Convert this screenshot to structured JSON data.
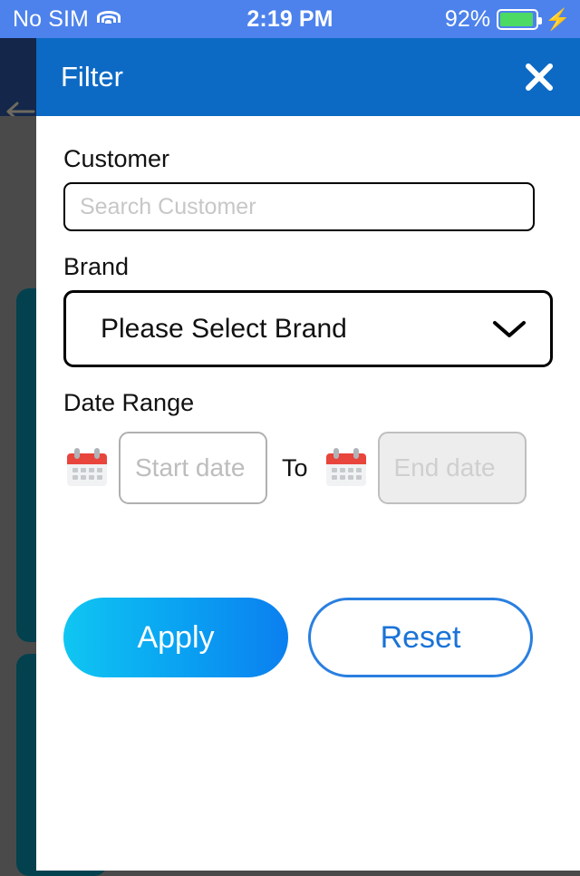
{
  "status_bar": {
    "carrier": "No SIM",
    "wifi_icon": "wifi-icon",
    "time": "2:19 PM",
    "battery_percent": "92%",
    "battery_icon": "battery-icon",
    "charging_icon": "lightning-bolt-icon",
    "background_color": "#4d82ec"
  },
  "background_app": {
    "back_icon": "back-arrow-icon",
    "appbar_color": "#14264a",
    "scrim_color": "#4a4a4a",
    "card_color": "#03414f"
  },
  "modal": {
    "title": "Filter",
    "close_icon": "close-icon",
    "header_color": "#0d6ac4",
    "customer": {
      "label": "Customer",
      "placeholder": "Search Customer",
      "value": ""
    },
    "brand": {
      "label": "Brand",
      "selected": "Please Select Brand",
      "chevron_icon": "chevron-down-icon"
    },
    "date_range": {
      "label": "Date Range",
      "start_calendar_icon": "calendar-icon",
      "start_placeholder": "Start date",
      "start_value": "",
      "separator": "To",
      "end_calendar_icon": "calendar-icon",
      "end_placeholder": "End date",
      "end_value": ""
    },
    "actions": {
      "apply_label": "Apply",
      "apply_gradient_from": "#10c6f2",
      "apply_gradient_to": "#0b7ff0",
      "reset_label": "Reset",
      "reset_color": "#1a73d8"
    }
  }
}
